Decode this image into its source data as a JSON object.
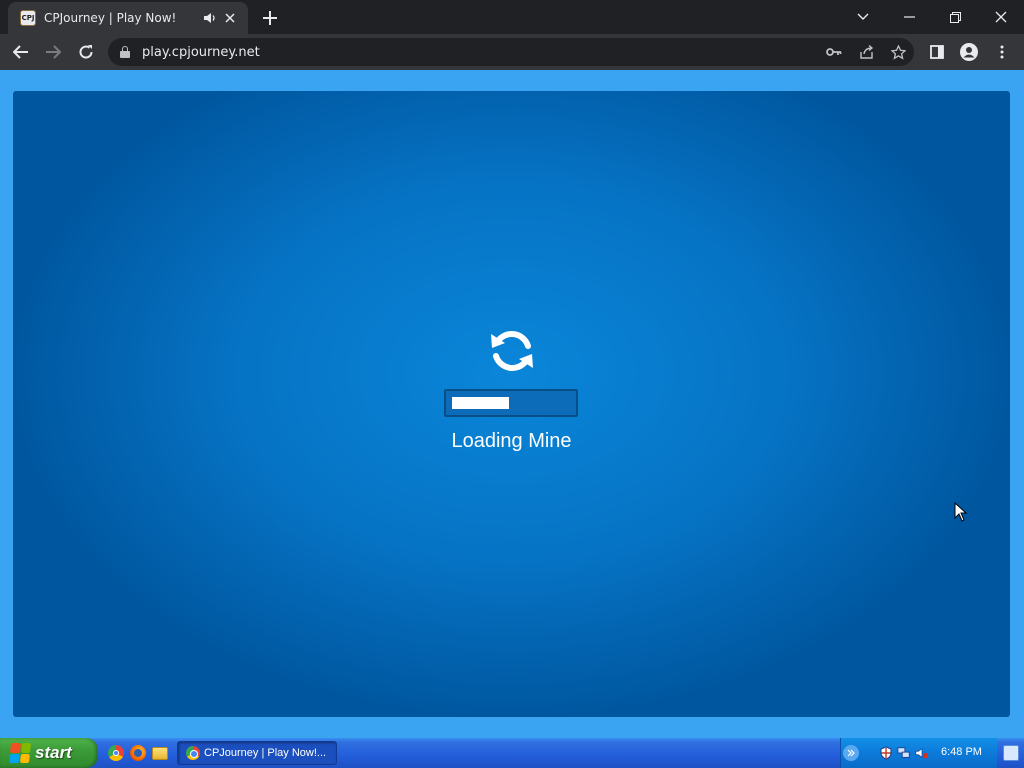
{
  "browser": {
    "tab": {
      "favicon_text": "CPJ",
      "title": "CPJourney | Play Now!",
      "audio_icon": "speaker-icon",
      "close_icon": "close-icon"
    },
    "new_tab_icon": "plus-icon",
    "window_controls": {
      "tab_search": "chevron-down-icon",
      "minimize": "minimize-icon",
      "restore": "restore-icon",
      "close": "close-icon"
    },
    "toolbar": {
      "back": "arrow-left-icon",
      "forward": "arrow-right-icon",
      "reload": "reload-icon",
      "url": "play.cpjourney.net",
      "omnibox_icons": [
        "key-icon",
        "share-icon",
        "star-icon"
      ],
      "side_panel": "side-panel-icon",
      "profile": "profile-icon",
      "menu": "kebab-menu-icon"
    }
  },
  "game": {
    "loading_icon": "refresh-icon",
    "loading_text": "Loading Mine",
    "progress": 0.48
  },
  "taskbar": {
    "start_label": "start",
    "quick_launch": [
      "chrome-icon",
      "firefox-icon",
      "folder-icon"
    ],
    "task_button_label": "CPJourney | Play Now!...",
    "tray_icons": [
      "chevron-icon",
      "security-shield-icon",
      "network-icon",
      "volume-icon"
    ],
    "clock": "6:48 PM"
  },
  "colors": {
    "page_bg": "#3aa3f2",
    "game_center": "#0a86d9",
    "game_edge": "#0057a0",
    "chrome_dark": "#202124",
    "chrome_toolbar": "#35363a",
    "taskbar_blue": "#245edb",
    "start_green": "#3c9c38"
  }
}
